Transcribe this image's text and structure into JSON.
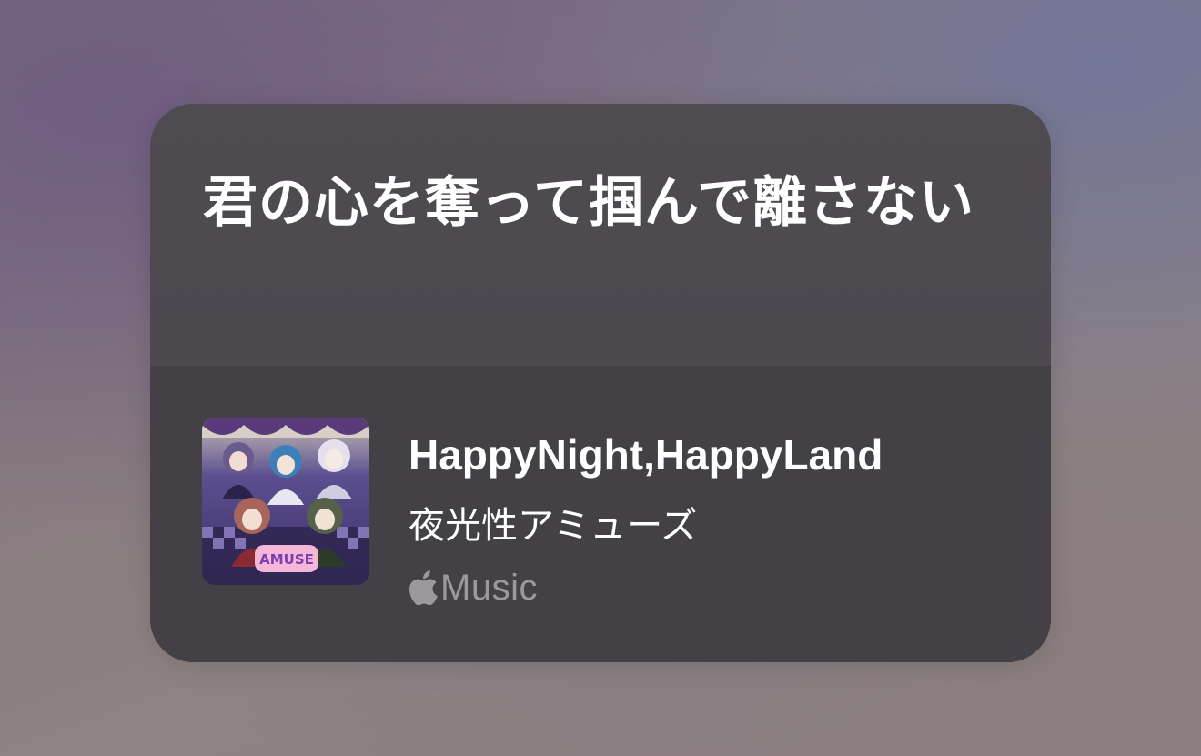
{
  "lyric_card": {
    "lyric_text": "君の心を奪って掴んで離さない"
  },
  "track": {
    "title": "HappyNight,HappyLand",
    "artist": "夜光性アミューズ",
    "service_name": "Music",
    "service_icon": "apple-logo-icon",
    "album_art_text": "AMUSE"
  },
  "colors": {
    "card_background": "#4b484e",
    "music_section_background": "#434046",
    "primary_text": "#ffffff",
    "secondary_text": "#9c999e"
  }
}
